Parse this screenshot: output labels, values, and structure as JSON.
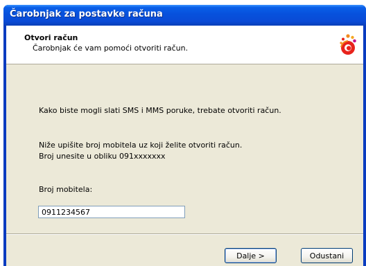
{
  "window": {
    "title": "Čarobnjak za postavke računa"
  },
  "header": {
    "title": "Otvori račun",
    "subtitle": "Čarobnjak će vam pomoći otvoriti račun.",
    "logo_icon": "operator-logo-icon",
    "logo_colors": {
      "main": "#e8231c",
      "dots": "#f28a1e",
      "accent": "#c4128c"
    }
  },
  "body": {
    "intro": "Kako biste mogli slati SMS i MMS poruke, trebate otvoriti račun.",
    "instruction": "Niže upišite broj mobitela uz koji želite otvoriti račun.",
    "format_hint": "Broj unesite u obliku 091xxxxxxx",
    "phone_label": "Broj mobitela:",
    "phone_value": "0911234567"
  },
  "buttons": {
    "next": "Dalje >",
    "cancel": "Odustani"
  }
}
